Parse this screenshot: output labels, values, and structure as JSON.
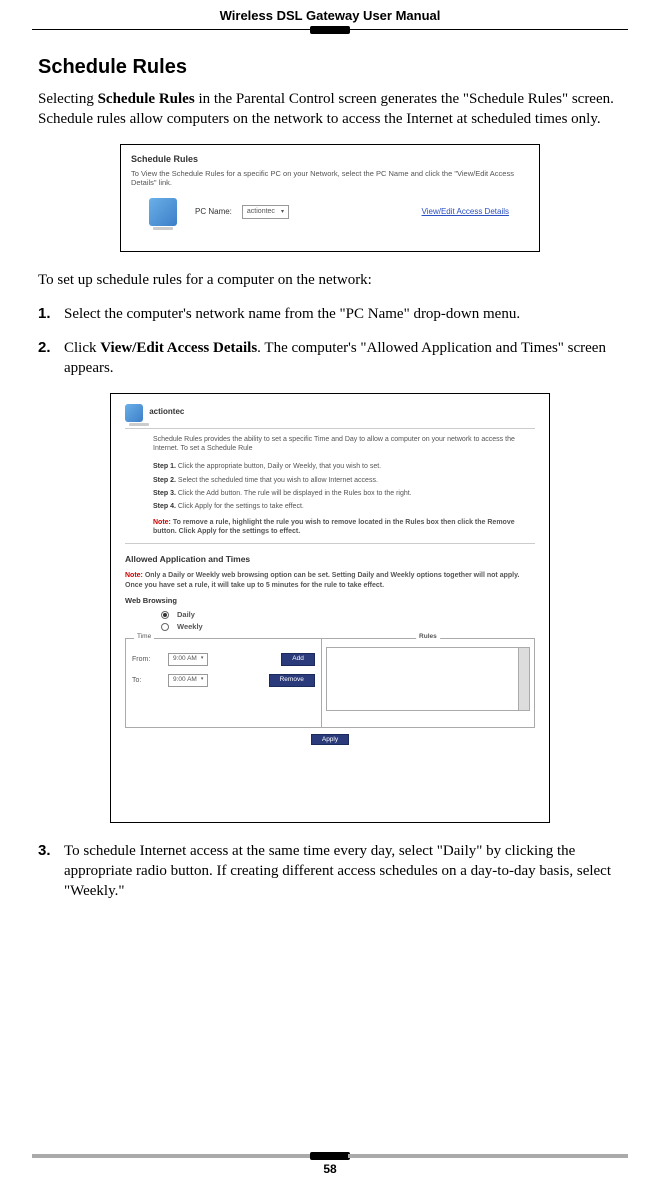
{
  "header": {
    "title": "Wireless DSL Gateway User Manual"
  },
  "section": {
    "heading": "Schedule Rules"
  },
  "intro": {
    "pre": "Selecting ",
    "bold": "Schedule Rules",
    "post": " in the Parental Control screen generates the \"Schedule Rules\" screen. Schedule rules allow computers on the network to access the Internet at scheduled times only."
  },
  "fig1": {
    "title": "Schedule Rules",
    "desc": "To View the Schedule Rules for a specific PC on your Network, select the PC Name and click the \"View/Edit Access Details\" link.",
    "pc_name_label": "PC Name:",
    "dropdown_value": "actiontec",
    "link_text": "View/Edit Access Details"
  },
  "lead": "To set up schedule rules for a computer on the network:",
  "steps": {
    "s1": {
      "num": "1.",
      "text": "Select the computer's network name from the \"PC Name\" drop-down menu."
    },
    "s2": {
      "num": "2.",
      "pre": "Click ",
      "bold": "View/Edit Access Details",
      "post": ". The computer's \"Allowed Application and Times\" screen appears."
    },
    "s3": {
      "num": "3.",
      "text": "To schedule Internet access at the same time every day, select \"Daily\" by clicking the appropriate radio button. If creating different access schedules on a day-to-day basis, select \"Weekly.\""
    }
  },
  "fig2": {
    "hostname": "actiontec",
    "para": "Schedule Rules provides the ability to set a specific Time and Day to allow a computer on your network to access the Internet. To set a Schedule Rule",
    "step1_b": "Step 1.",
    "step1_t": " Click the appropriate button, Daily or Weekly, that you wish to set.",
    "step2_b": "Step 2.",
    "step2_t": " Select the scheduled time that you wish to allow Internet access.",
    "step3_b": "Step 3.",
    "step3_t": " Click the Add button. The rule will be displayed in the Rules box to the right.",
    "step4_b": "Step 4.",
    "step4_t": " Click Apply for the settings to take effect.",
    "note1_label": "Note:",
    "note1_text": " To remove a rule, highlight the rule you wish to remove located in the Rules box then click the Remove button. Click Apply for the settings to effect.",
    "section_title": "Allowed Application and Times",
    "note2_label": "Note:",
    "note2_text": " Only a Daily or Weekly web browsing option can be set. Setting Daily and Weekly options together will not apply. Once you have set a rule, it will take up to 5 minutes for the rule to take effect.",
    "web_browsing": "Web Browsing",
    "radio_daily": "Daily",
    "radio_weekly": "Weekly",
    "time_legend": "Time",
    "rules_legend": "Rules",
    "from_label": "From:",
    "to_label": "To:",
    "from_value": "9:00 AM",
    "to_value": "9:00 AM",
    "add_btn": "Add",
    "remove_btn": "Remove",
    "apply_btn": "Apply"
  },
  "footer": {
    "page": "58"
  }
}
